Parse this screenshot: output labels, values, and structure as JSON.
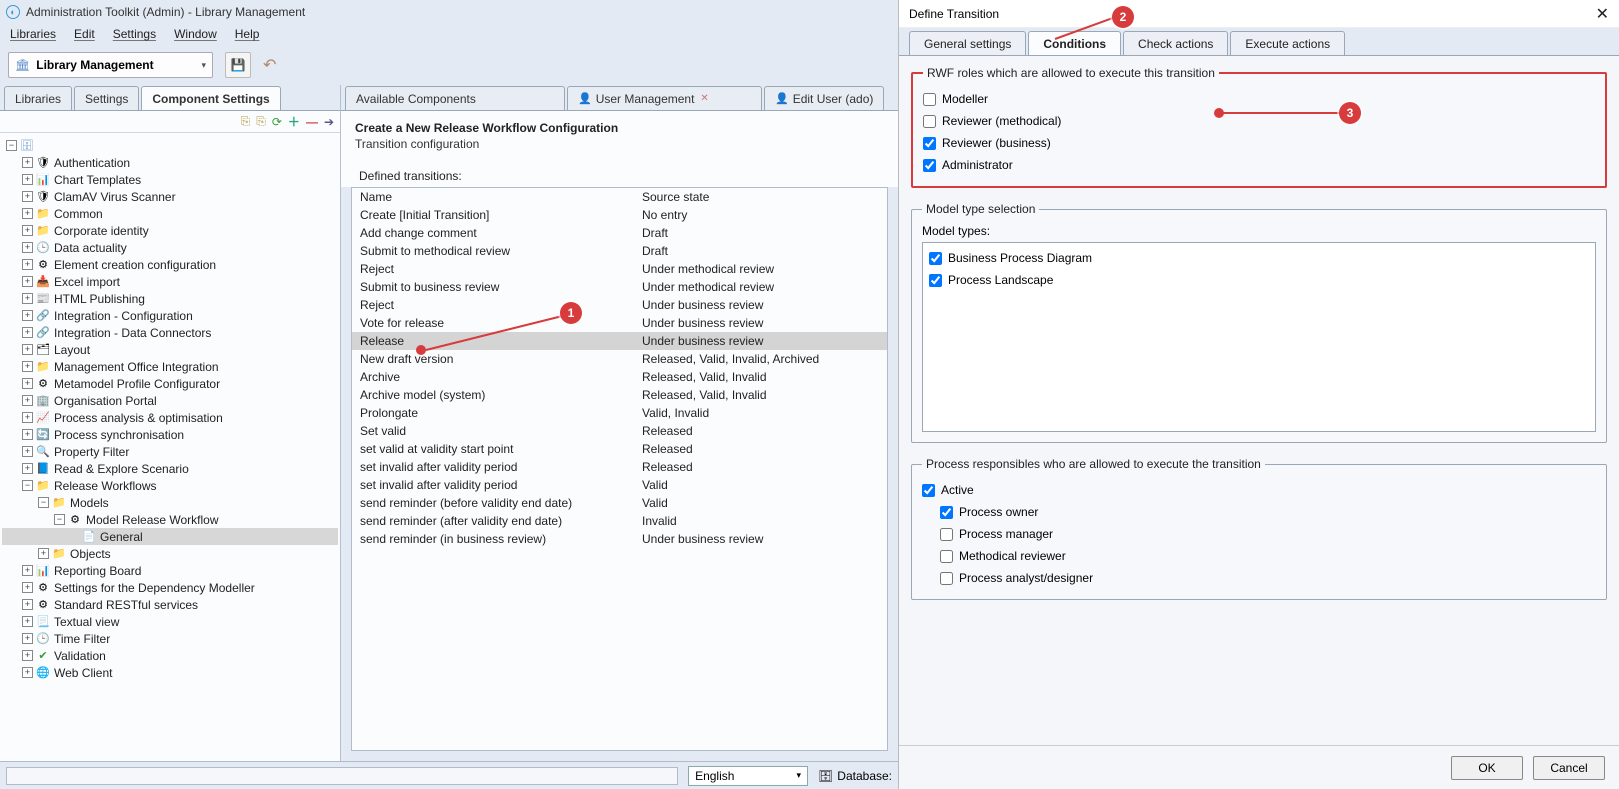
{
  "window": {
    "title": "Administration Toolkit (Admin) - Library Management"
  },
  "menu": {
    "libraries": "Libraries",
    "edit": "Edit",
    "settings": "Settings",
    "window": "Window",
    "help": "Help"
  },
  "toolrow": {
    "library_dd": "Library Management"
  },
  "left_tabs": {
    "libraries": "Libraries",
    "settings": "Settings",
    "component_settings": "Component Settings"
  },
  "right_tabs": {
    "available": "Available Components",
    "user_mgmt": "User Management",
    "edit_user": "Edit User (ado)"
  },
  "cfg": {
    "title": "Create a New Release Workflow Configuration",
    "subtitle": "Transition configuration",
    "defined": "Defined transitions:"
  },
  "trans_hdr": {
    "name": "Name",
    "source": "Source state"
  },
  "transitions": [
    {
      "name": "Create [Initial Transition]",
      "source": "No entry"
    },
    {
      "name": "Add change comment",
      "source": "Draft"
    },
    {
      "name": "Submit to methodical review",
      "source": "Draft"
    },
    {
      "name": "Reject",
      "source": "Under methodical review"
    },
    {
      "name": "Submit to business review",
      "source": "Under methodical review"
    },
    {
      "name": "Reject",
      "source": "Under business review"
    },
    {
      "name": "Vote for release",
      "source": "Under business review"
    },
    {
      "name": "Release",
      "source": "Under business review"
    },
    {
      "name": "New draft version",
      "source": "Released, Valid, Invalid, Archived"
    },
    {
      "name": "Archive",
      "source": "Released, Valid, Invalid"
    },
    {
      "name": "Archive model (system)",
      "source": "Released, Valid, Invalid"
    },
    {
      "name": "Prolongate",
      "source": "Valid, Invalid"
    },
    {
      "name": "Set valid",
      "source": "Released"
    },
    {
      "name": "set valid at validity start point",
      "source": "Released"
    },
    {
      "name": "set invalid after validity period",
      "source": "Released"
    },
    {
      "name": "set invalid after validity period",
      "source": "Valid"
    },
    {
      "name": "send reminder (before validity end date)",
      "source": "Valid"
    },
    {
      "name": "send reminder (after validity end date)",
      "source": "Invalid"
    },
    {
      "name": "send reminder (in business review)",
      "source": "Under business review"
    }
  ],
  "tree": [
    {
      "lbl": "Authentication",
      "ic": "ic-shield",
      "ind": 2,
      "exp": "+"
    },
    {
      "lbl": "Chart Templates",
      "ic": "ic-chart",
      "ind": 2,
      "exp": "+"
    },
    {
      "lbl": "ClamAV Virus Scanner",
      "ic": "ic-bug",
      "ind": 2,
      "exp": "+"
    },
    {
      "lbl": "Common",
      "ic": "ic-fold",
      "ind": 2,
      "exp": "+"
    },
    {
      "lbl": "Corporate identity",
      "ic": "ic-fold",
      "ind": 2,
      "exp": "+"
    },
    {
      "lbl": "Data actuality",
      "ic": "ic-clock",
      "ind": 2,
      "exp": "+"
    },
    {
      "lbl": "Element creation configuration",
      "ic": "ic-cog",
      "ind": 2,
      "exp": "+"
    },
    {
      "lbl": "Excel import",
      "ic": "ic-excel",
      "ind": 2,
      "exp": "+"
    },
    {
      "lbl": "HTML Publishing",
      "ic": "ic-html",
      "ind": 2,
      "exp": "+"
    },
    {
      "lbl": "Integration - Configuration",
      "ic": "ic-link",
      "ind": 2,
      "exp": "+"
    },
    {
      "lbl": "Integration - Data Connectors",
      "ic": "ic-link",
      "ind": 2,
      "exp": "+"
    },
    {
      "lbl": "Layout",
      "ic": "ic-layout",
      "ind": 2,
      "exp": "+"
    },
    {
      "lbl": "Management Office Integration",
      "ic": "ic-fold",
      "ind": 2,
      "exp": "+"
    },
    {
      "lbl": "Metamodel Profile Configurator",
      "ic": "ic-cog",
      "ind": 2,
      "exp": "+"
    },
    {
      "lbl": "Organisation Portal",
      "ic": "ic-org",
      "ind": 2,
      "exp": "+"
    },
    {
      "lbl": "Process analysis & optimisation",
      "ic": "ic-proc",
      "ind": 2,
      "exp": "+"
    },
    {
      "lbl": "Process synchronisation",
      "ic": "ic-sync",
      "ind": 2,
      "exp": "+"
    },
    {
      "lbl": "Property Filter",
      "ic": "ic-filter",
      "ind": 2,
      "exp": "+"
    },
    {
      "lbl": "Read & Explore Scenario",
      "ic": "ic-book",
      "ind": 2,
      "exp": "+"
    },
    {
      "lbl": "Release Workflows",
      "ic": "ic-fold",
      "ind": 2,
      "exp": "−"
    },
    {
      "lbl": "Models",
      "ic": "ic-fold",
      "ind": 3,
      "exp": "−"
    },
    {
      "lbl": "Model Release Workflow",
      "ic": "ic-cog",
      "ind": 4,
      "exp": "−"
    },
    {
      "lbl": "General",
      "ic": "ic-doc",
      "ind": 5,
      "exp": "",
      "sel": true
    },
    {
      "lbl": "Objects",
      "ic": "ic-fold",
      "ind": 3,
      "exp": "+"
    },
    {
      "lbl": "Reporting Board",
      "ic": "ic-chart",
      "ind": 2,
      "exp": "+"
    },
    {
      "lbl": "Settings for the Dependency Modeller",
      "ic": "ic-cog",
      "ind": 2,
      "exp": "+"
    },
    {
      "lbl": "Standard RESTful services",
      "ic": "ic-cog",
      "ind": 2,
      "exp": "+"
    },
    {
      "lbl": "Textual view",
      "ic": "ic-text",
      "ind": 2,
      "exp": "+"
    },
    {
      "lbl": "Time Filter",
      "ic": "ic-clock",
      "ind": 2,
      "exp": "+"
    },
    {
      "lbl": "Validation",
      "ic": "ic-check",
      "ind": 2,
      "exp": "+"
    },
    {
      "lbl": "Web Client",
      "ic": "ic-globe",
      "ind": 2,
      "exp": "+"
    }
  ],
  "status": {
    "language": "English",
    "database": "Database:"
  },
  "dialog": {
    "title": "Define Transition",
    "tabs": {
      "general": "General settings",
      "conditions": "Conditions",
      "check": "Check actions",
      "execute": "Execute actions"
    },
    "roles_legend": "RWF roles which are allowed to execute this transition",
    "roles": {
      "modeller": "Modeller",
      "rev_method": "Reviewer (methodical)",
      "rev_business": "Reviewer (business)",
      "admin": "Administrator"
    },
    "model_legend": "Model type selection",
    "model_types_lbl": "Model types:",
    "model_types": {
      "bpd": "Business Process Diagram",
      "pl": "Process Landscape"
    },
    "proc_legend": "Process responsibles who are allowed to execute the transition",
    "proc": {
      "active": "Active",
      "owner": "Process owner",
      "manager": "Process manager",
      "method": "Methodical reviewer",
      "analyst": "Process analyst/designer"
    },
    "ok": "OK",
    "cancel": "Cancel"
  },
  "annotations": {
    "a1": "1",
    "a2": "2",
    "a3": "3"
  }
}
